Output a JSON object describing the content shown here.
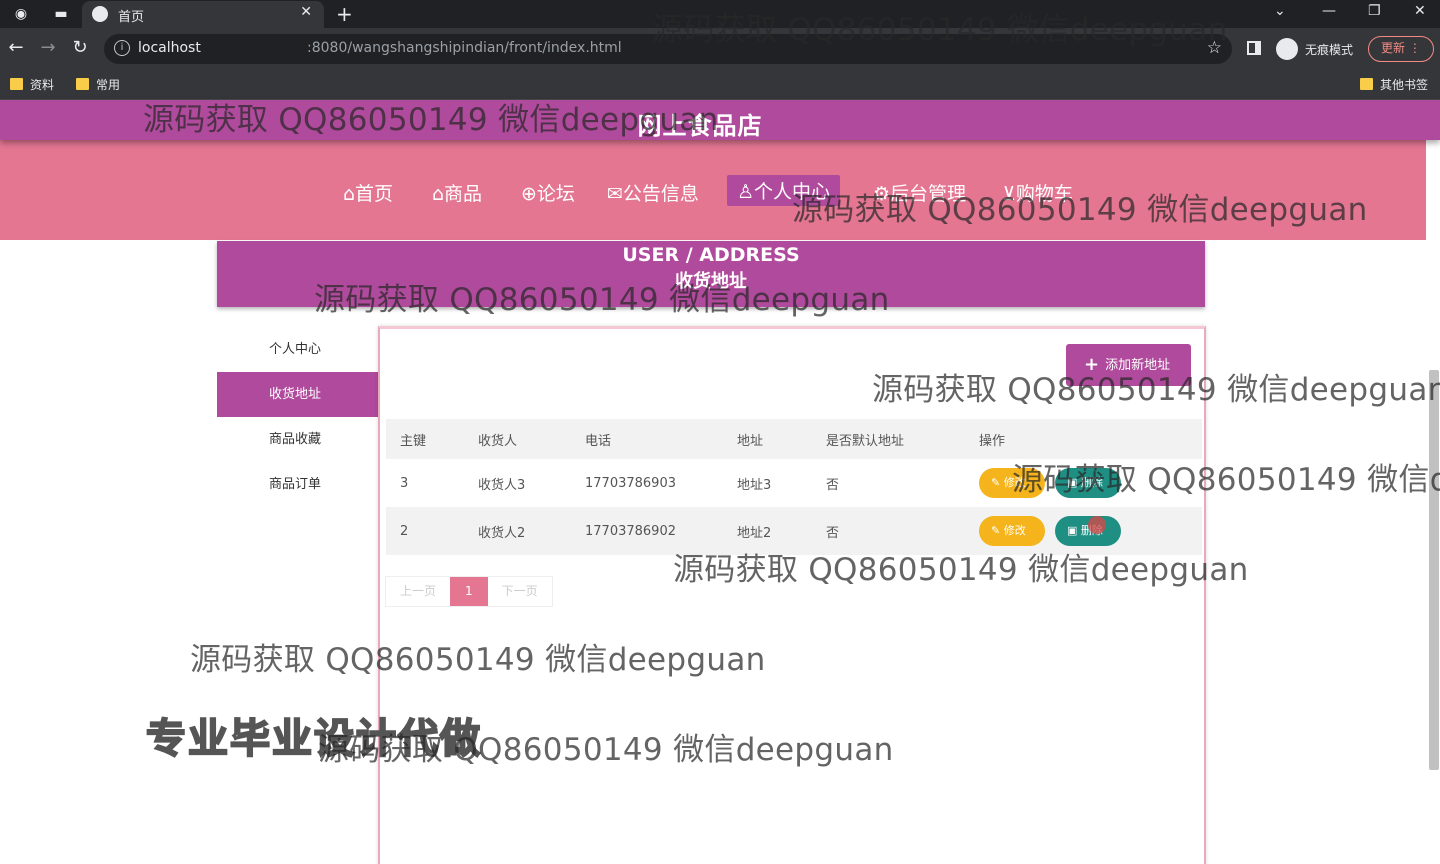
{
  "browser": {
    "tab_title": "首页",
    "url_host": "localhost",
    "url_path": ":8080/wangshangshipindian/front/index.html",
    "incognito_label": "无痕模式",
    "update_label": "更新",
    "bookmarks": [
      "资料",
      "常用"
    ],
    "other_bookmarks": "其他书签"
  },
  "site": {
    "title": "网上食品店",
    "nav": [
      {
        "icon": "home-icon",
        "label": "⌂首页"
      },
      {
        "icon": "tag-icon",
        "label": "⌂商品"
      },
      {
        "icon": "forum-icon",
        "label": "论坛"
      },
      {
        "icon": "mail-icon",
        "label": "公告信息"
      },
      {
        "icon": "user-icon",
        "label": "个人中心"
      },
      {
        "icon": "admin-icon",
        "label": "后台管理"
      },
      {
        "icon": "cart-icon",
        "label": "购物车"
      }
    ]
  },
  "banner": {
    "en": "USER / ADDRESS",
    "cn": "收货地址"
  },
  "side_menu": [
    "个人中心",
    "收货地址",
    "商品收藏",
    "商品订单"
  ],
  "add_button": "添加新地址",
  "table": {
    "headers": [
      "主键",
      "收货人",
      "电话",
      "地址",
      "是否默认地址",
      "操作"
    ],
    "rows": [
      [
        "3",
        "收货人3",
        "17703786903",
        "地址3",
        "否"
      ],
      [
        "2",
        "收货人2",
        "17703786902",
        "地址2",
        "否"
      ]
    ],
    "edit_label": "修改",
    "delete_label": "删除"
  },
  "pagination": {
    "prev": "上一页",
    "current": "1",
    "next": "下一页"
  },
  "overlay": {
    "watermark": "源码获取 QQ86050149 微信deepguan",
    "watermark_cut": "源码获取 QQ86050149 微信de",
    "promo": "专业毕业设计代做"
  }
}
